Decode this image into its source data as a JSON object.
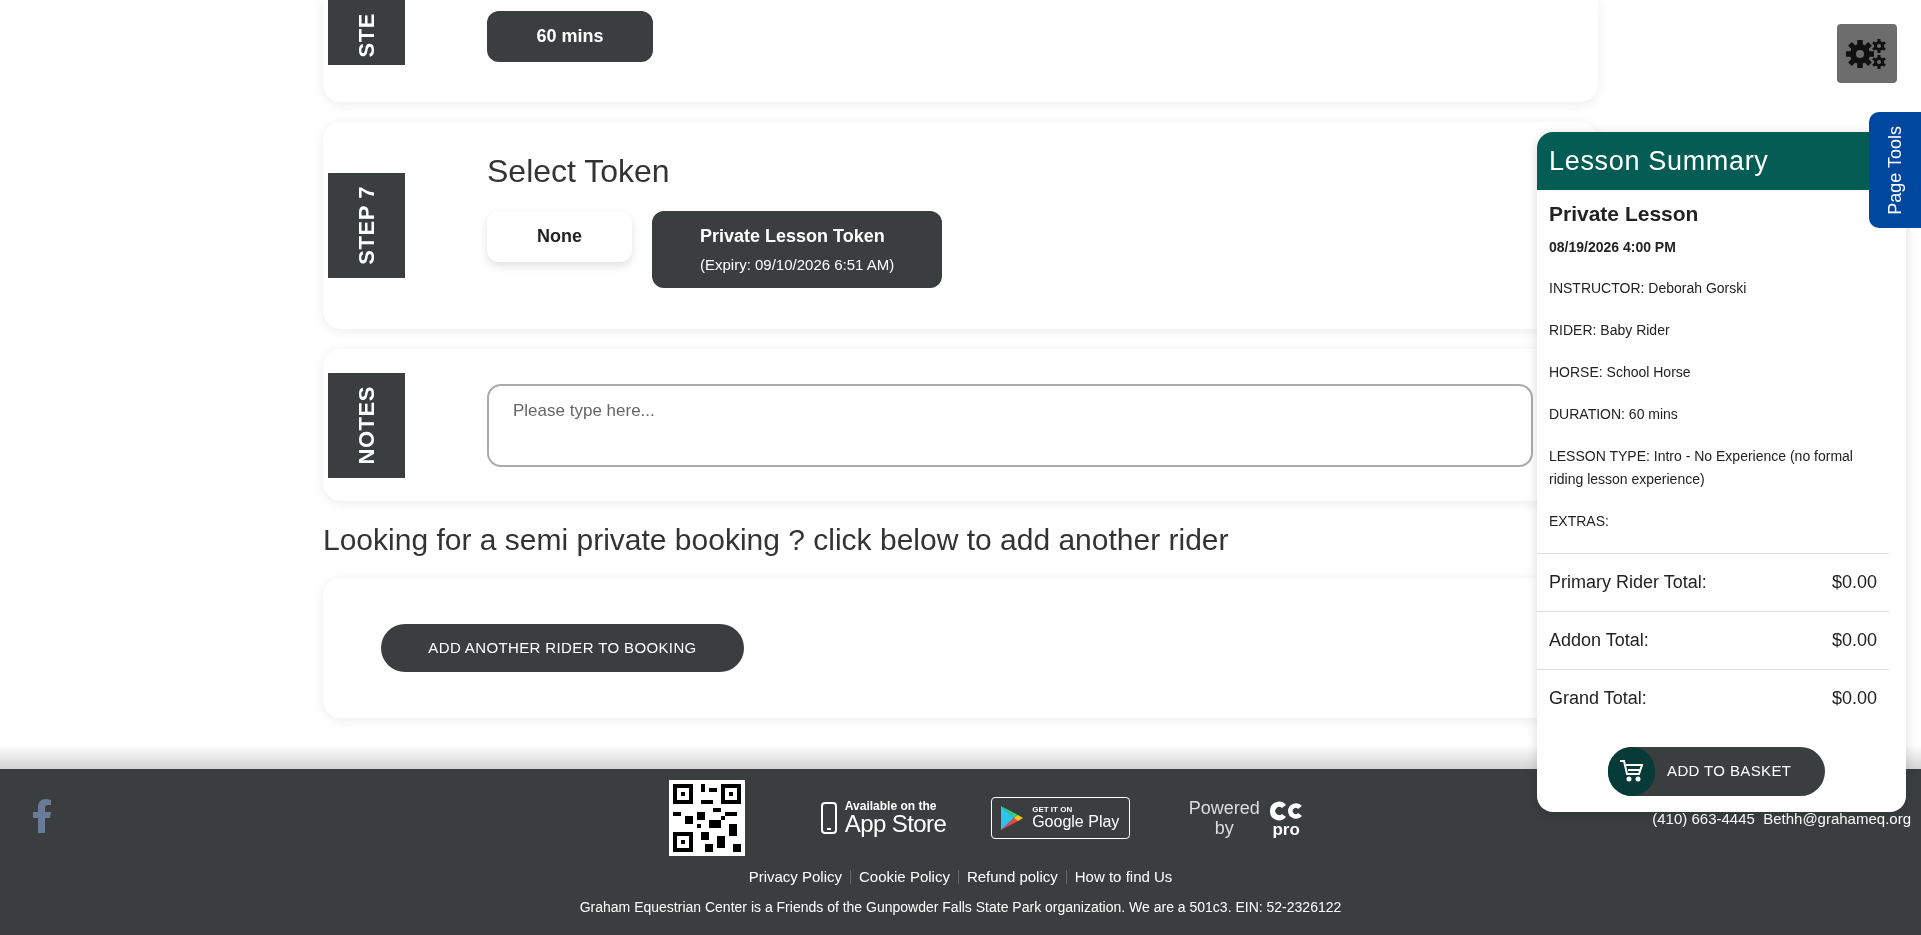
{
  "steps": [
    {
      "kind": "options",
      "label": "STE",
      "options": [
        {
          "title": "60 mins",
          "selected": true
        }
      ]
    },
    {
      "kind": "options",
      "label": "STEP 7",
      "title": "Select Token",
      "options": [
        {
          "title": "None",
          "selected": false
        },
        {
          "title": "Private Lesson Token",
          "subtitle": "(Expiry: 09/10/2026 6:51 AM)",
          "selected": true
        }
      ]
    },
    {
      "kind": "notes",
      "label": "NOTES",
      "placeholder": "Please type here..."
    }
  ],
  "semi_private_heading": "Looking for a semi private booking ? click below to add another rider",
  "add_rider_button": "ADD ANOTHER RIDER TO BOOKING",
  "page_tools": "Page Tools",
  "summary": {
    "title": "Lesson Summary",
    "lesson": "Private Lesson",
    "date": "08/19/2026 4:00 PM",
    "details": [
      "INSTRUCTOR: Deborah Gorski",
      "RIDER: Baby Rider",
      "HORSE: School Horse",
      "DURATION: 60 mins",
      "LESSON TYPE: Intro - No Experience (no formal riding lesson experience)",
      "EXTRAS:"
    ],
    "totals": [
      {
        "label": "Primary Rider Total:",
        "value": "$0.00"
      },
      {
        "label": "Addon Total:",
        "value": "$0.00"
      },
      {
        "label": "Grand Total:",
        "value": "$0.00"
      }
    ],
    "button": "ADD TO BASKET"
  },
  "footer": {
    "app_store": {
      "small": "Available on the",
      "big": "App Store"
    },
    "google_play": {
      "small": "GET IT ON",
      "big": "Google Play"
    },
    "powered_by": "Powered by",
    "logo_text": "pro",
    "contact": "(410) 663-4445  Bethh@grahameq.org",
    "links": [
      "Privacy Policy",
      "Cookie Policy",
      "Refund policy",
      "How to find Us"
    ],
    "note": "Graham Equestrian Center is a Friends of the Gunpowder Falls State Park organization. We are a 501c3. EIN: 52-2326122"
  }
}
